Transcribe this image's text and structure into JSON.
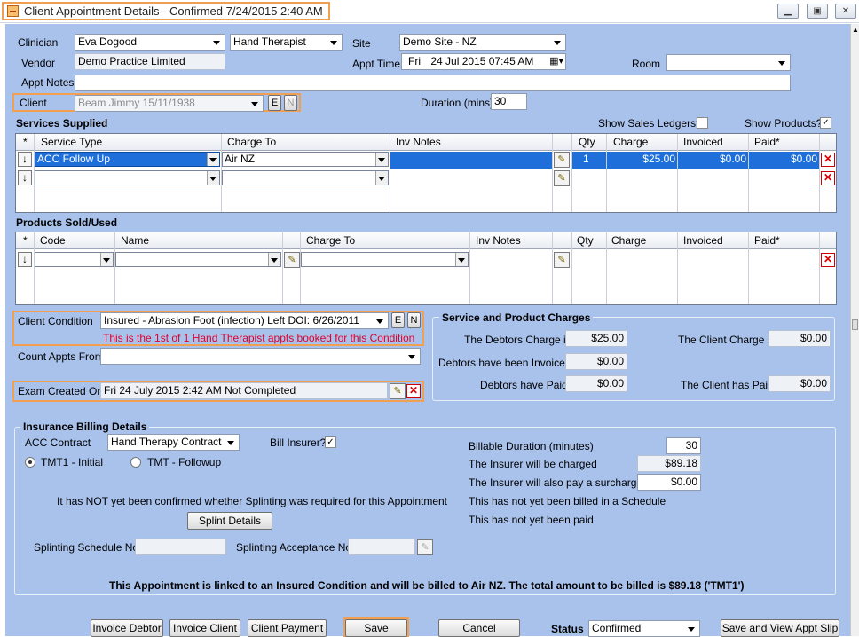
{
  "window": {
    "title": "Client Appointment Details - Confirmed 7/24/2015 2:40 AM",
    "minimize_icon": "minimize-icon",
    "restore_icon": "restore-icon",
    "close_icon": "close-icon"
  },
  "appointment": {
    "clinician_label": "Clinician",
    "clinician_value": "Eva Dogood",
    "role_value": "Hand Therapist",
    "site_label": "Site",
    "site_value": "Demo Site - NZ",
    "vendor_label": "Vendor",
    "vendor_value": "Demo Practice Limited",
    "appt_time_label": "Appt Time",
    "appt_time_day": "Fri",
    "appt_time_value": "24  Jul  2015 07:45 AM",
    "room_label": "Room",
    "room_value": "",
    "appt_notes_label": "Appt Notes",
    "appt_notes_value": "",
    "client_label": "Client",
    "client_value": "Beam Jimmy 15/11/1938",
    "client_e": "E",
    "client_n": "N",
    "duration_label": "Duration (mins)",
    "duration_value": "30"
  },
  "services": {
    "title": "Services Supplied",
    "show_sales_label": "Show Sales Ledgers?",
    "show_products_label": "Show Products?",
    "show_products_checked": "✓",
    "headers": [
      "*",
      "Service Type",
      "Charge To",
      "Inv Notes",
      "Qty",
      "Charge",
      "Invoiced",
      "Paid*"
    ],
    "rows": [
      {
        "service": "ACC Follow Up",
        "charge_to": "Air NZ",
        "notes": "",
        "qty": "1",
        "charge": "$25.00",
        "invoiced": "$0.00",
        "paid": "$0.00"
      },
      {
        "service": "",
        "charge_to": "",
        "notes": "",
        "qty": "",
        "charge": "",
        "invoiced": "",
        "paid": ""
      }
    ]
  },
  "products": {
    "title": "Products Sold/Used",
    "headers": [
      "*",
      "Code",
      "Name",
      "Charge To",
      "Inv Notes",
      "Qty",
      "Charge",
      "Invoiced",
      "Paid*"
    ]
  },
  "condition": {
    "label": "Client Condition",
    "value": "Insured -  Abrasion Foot (infection) Left DOI: 6/26/2011",
    "e": "E",
    "n": "N",
    "note": "This is the 1st of 1 Hand Therapist appts booked for this Condition",
    "count_label": "Count Appts From",
    "count_value": "",
    "exam_label": "Exam Created On",
    "exam_value": "Fri 24 July 2015 2:42 AM Not Completed"
  },
  "charges": {
    "title": "Service and Product Charges",
    "debtors_charge_label": "The Debtors Charge is",
    "debtors_charge": "$25.00",
    "client_charge_label": "The Client Charge is",
    "client_charge": "$0.00",
    "debtors_invoiced_label": "Debtors have been Invoiced",
    "debtors_invoiced": "$0.00",
    "debtors_paid_label": "Debtors have Paid",
    "debtors_paid": "$0.00",
    "client_paid_label": "The Client has Paid",
    "client_paid": "$0.00"
  },
  "insurance": {
    "title": "Insurance Billing Details",
    "acc_label": "ACC Contract",
    "acc_value": "Hand Therapy Contract",
    "bill_insurer_label": "Bill Insurer?",
    "bill_insurer_checked": "✓",
    "radio1": "TMT1 - Initial",
    "radio2": "TMT - Followup",
    "splinting_note": "It has NOT yet been confirmed whether Splinting was required for this Appointment",
    "splint_button": "Splint Details",
    "schedule_label": "Splinting Schedule No",
    "schedule_value": "",
    "acceptance_label": "Splinting Acceptance No",
    "acceptance_value": "",
    "billable_label": "Billable Duration (minutes)",
    "billable_value": "30",
    "insurer_charged_label": "The Insurer will be charged",
    "insurer_charged": "$89.18",
    "surcharge_label": "The Insurer will also pay a surcharge of",
    "surcharge": "$0.00",
    "schedule_status": "This has not yet been billed in a Schedule",
    "paid_status": "This has not yet been paid",
    "summary": "This Appointment is linked to an Insured Condition and will be billed to Air NZ.  The total amount to be billed is $89.18 ('TMT1')"
  },
  "footer": {
    "invoice_debtor": "Invoice Debtor",
    "invoice_client": "Invoice Client",
    "client_payment": "Client Payment",
    "save": "Save",
    "cancel": "Cancel",
    "status_label": "Status",
    "status_value": "Confirmed",
    "save_view": "Save and View Appt Slip"
  }
}
